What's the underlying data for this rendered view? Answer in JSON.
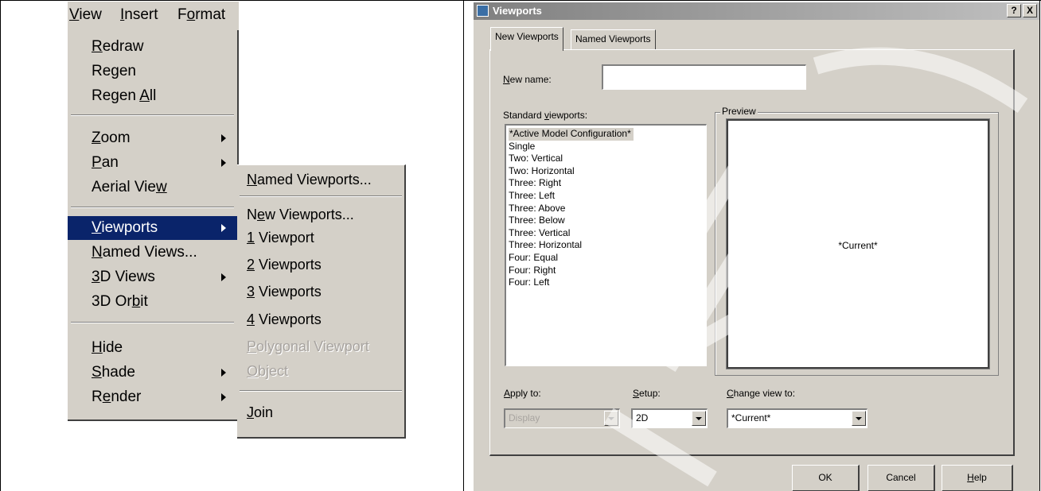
{
  "menubar": {
    "items": [
      {
        "label": "View",
        "ul": "V",
        "rest": "iew"
      },
      {
        "label": "Insert",
        "ul": "I",
        "rest": "nsert"
      },
      {
        "label": "Format",
        "pre": "F",
        "ul": "o",
        "rest": "rmat"
      }
    ]
  },
  "view_menu": {
    "redraw": {
      "ul": "R",
      "rest": "edraw"
    },
    "regen": "Regen",
    "regen_all": {
      "pre": "Regen ",
      "ul": "A",
      "rest": "ll"
    },
    "zoom": {
      "ul": "Z",
      "rest": "oom"
    },
    "pan": {
      "ul": "P",
      "rest": "an"
    },
    "aerial_view": {
      "pre": "Aerial Vie",
      "ul": "w",
      "rest": ""
    },
    "viewports": {
      "ul": "V",
      "rest": "iewports"
    },
    "named_views": {
      "ul": "N",
      "rest": "amed Views..."
    },
    "views_3d": {
      "ul": "3",
      "rest": "D Views"
    },
    "orbit_3d": {
      "pre": "3D Or",
      "ul": "b",
      "rest": "it"
    },
    "hide": {
      "ul": "H",
      "rest": "ide"
    },
    "shade": {
      "ul": "S",
      "rest": "hade"
    },
    "render": {
      "pre": "R",
      "ul": "e",
      "rest": "nder"
    }
  },
  "viewports_submenu": {
    "named_viewports": {
      "ul": "N",
      "rest": "amed Viewports..."
    },
    "new_viewports": {
      "pre": "N",
      "ul": "e",
      "rest": "w Viewports..."
    },
    "one_viewport": {
      "ul": "1",
      "rest": " Viewport"
    },
    "two_viewports": {
      "ul": "2",
      "rest": " Viewports"
    },
    "three_viewports": {
      "ul": "3",
      "rest": " Viewports"
    },
    "four_viewports": {
      "ul": "4",
      "rest": " Viewports"
    },
    "polygonal_viewport": {
      "ul": "P",
      "rest": "olygonal Viewport"
    },
    "object": {
      "ul": "O",
      "rest": "bject"
    },
    "join": {
      "ul": "J",
      "rest": "oin"
    }
  },
  "dialog": {
    "title": "Viewports",
    "help_glyph": "?",
    "close_glyph": "X",
    "tabs": [
      "New Viewports",
      "Named Viewports"
    ],
    "new_name_label": {
      "ul": "N",
      "rest": "ew name:"
    },
    "new_name_value": "",
    "standard_label": {
      "pre": "Standard ",
      "ul": "v",
      "rest": "iewports:"
    },
    "standard_viewports": [
      "*Active Model Configuration*",
      "Single",
      "Two:  Vertical",
      "Two:  Horizontal",
      "Three: Right",
      "Three: Left",
      "Three: Above",
      "Three: Below",
      "Three: Vertical",
      "Three: Horizontal",
      "Four:  Equal",
      "Four:  Right",
      "Four:  Left"
    ],
    "preview_title": "Preview",
    "preview_text": "*Current*",
    "apply_to_label": {
      "ul": "A",
      "rest": "pply to:"
    },
    "apply_to_value": "Display",
    "setup_label": {
      "ul": "S",
      "rest": "etup:"
    },
    "setup_value": "2D",
    "change_view_label": {
      "ul": "C",
      "rest": "hange view to:"
    },
    "change_view_value": "*Current*",
    "ok_label": "OK",
    "cancel_label": "Cancel",
    "help_label": {
      "ul": "H",
      "rest": "elp"
    }
  },
  "colors": {
    "menu_face": "#d4d0c8",
    "highlight": "#0a246a",
    "disabled_text": "#a8a4a0"
  }
}
